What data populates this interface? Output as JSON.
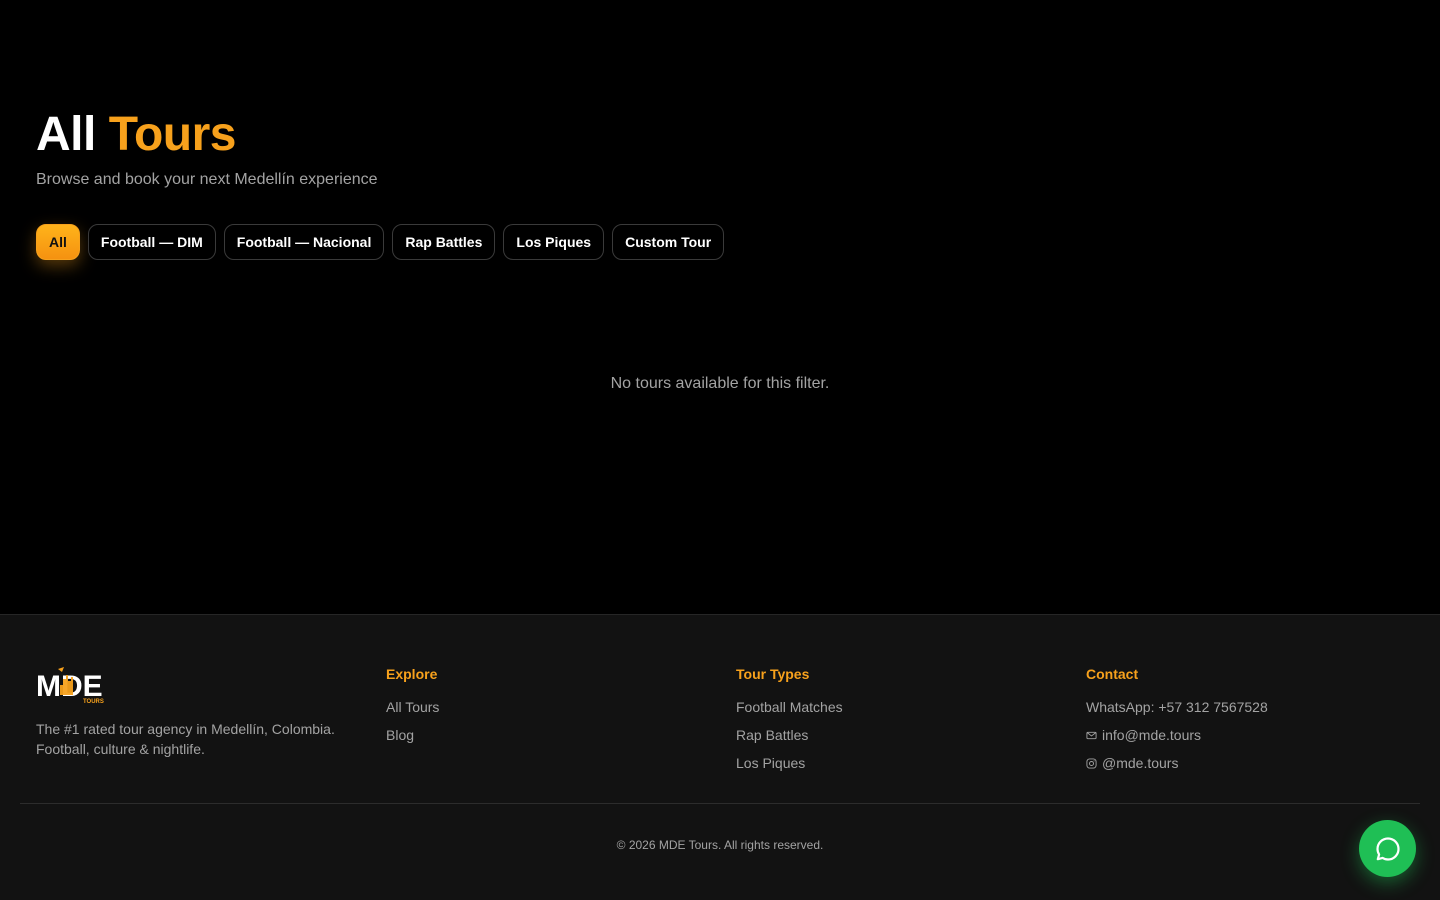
{
  "hero": {
    "title_main": "All",
    "title_accent": "Tours",
    "subtitle": "Browse and book your next Medellín experience"
  },
  "filters": [
    {
      "label": "All",
      "active": true
    },
    {
      "label": "Football — DIM",
      "active": false
    },
    {
      "label": "Football — Nacional",
      "active": false
    },
    {
      "label": "Rap Battles",
      "active": false
    },
    {
      "label": "Los Piques",
      "active": false
    },
    {
      "label": "Custom Tour",
      "active": false
    }
  ],
  "empty_state": "No tours available for this filter.",
  "footer": {
    "logo_text": "MDE",
    "logo_subtext": "TOURS",
    "brand_description": "The #1 rated tour agency in Medellín, Colombia. Football, culture & nightlife.",
    "explore": {
      "heading": "Explore",
      "links": [
        "All Tours",
        "Blog"
      ]
    },
    "tour_types": {
      "heading": "Tour Types",
      "links": [
        "Football Matches",
        "Rap Battles",
        "Los Piques"
      ]
    },
    "contact": {
      "heading": "Contact",
      "whatsapp": "WhatsApp: +57 312 7567528",
      "email": "info@mde.tours",
      "instagram": "@mde.tours"
    },
    "copyright": "© 2026 MDE Tours. All rights reserved."
  },
  "colors": {
    "accent": "#f7a11c",
    "background": "#000000",
    "footer_bg": "#121212",
    "chat_green": "#1fbf55"
  },
  "icons": {
    "email": "mail-icon",
    "instagram": "instagram-icon",
    "chat": "chat-bubble-icon"
  }
}
